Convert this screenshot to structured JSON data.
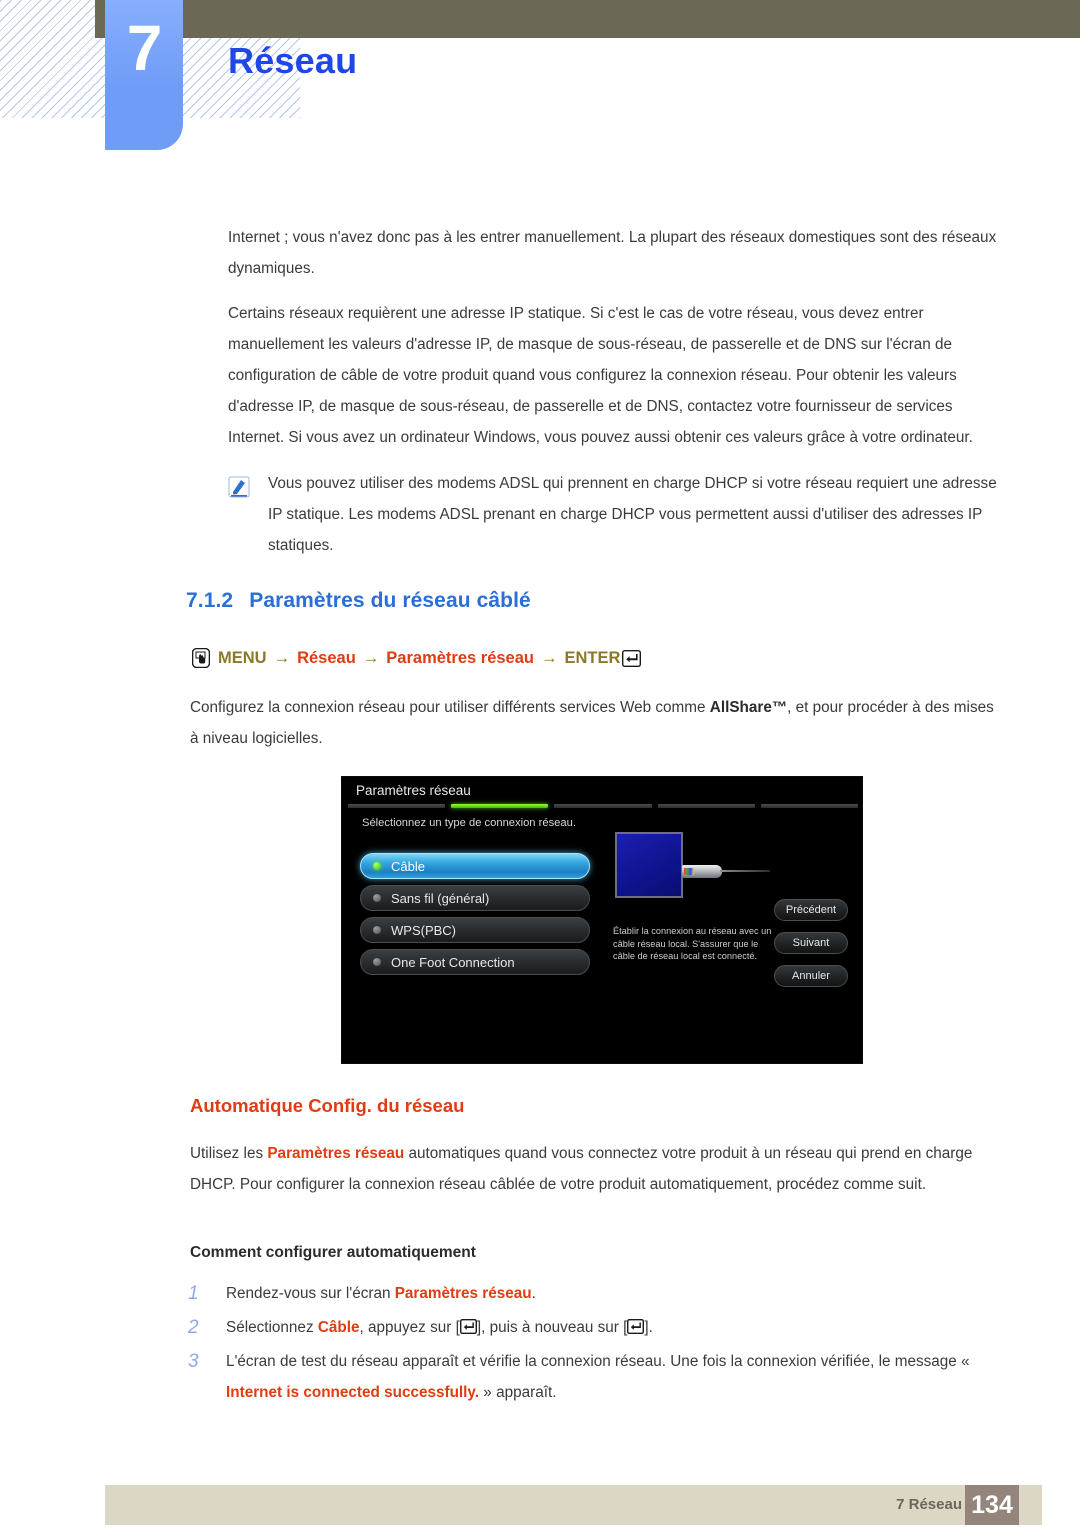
{
  "header": {
    "chapter_number": "7",
    "chapter_title": "Réseau"
  },
  "body": {
    "paragraph_1": "Internet ; vous n'avez donc pas à les entrer manuellement. La plupart des réseaux domestiques sont des réseaux dynamiques.",
    "paragraph_2": "Certains réseaux requièrent une adresse IP statique. Si c'est le cas de votre réseau, vous devez entrer manuellement les valeurs d'adresse IP, de masque de sous-réseau, de passerelle et de DNS sur l'écran de configuration de câble de votre produit quand vous configurez la connexion réseau. Pour obtenir les valeurs d'adresse IP, de masque de sous-réseau, de passerelle et de DNS, contactez votre fournisseur de services Internet. Si vous avez un ordinateur Windows, vous pouvez aussi obtenir ces valeurs grâce à votre ordinateur.",
    "note_text": "Vous pouvez utiliser des modems ADSL qui prennent en charge DHCP si votre réseau requiert une adresse IP statique. Les modems ADSL prenant en charge DHCP vous permettent aussi d'utiliser des adresses IP statiques."
  },
  "section": {
    "number": "7.1.2",
    "title": "Paramètres du réseau câblé"
  },
  "menu_path": {
    "item_1": "MENU",
    "arrow_1": "→",
    "item_2": "Réseau",
    "arrow_2": "→",
    "item_3": "Paramètres réseau",
    "arrow_3": "→",
    "item_4": "ENTER"
  },
  "intro": {
    "text_part_1": "Configurez la connexion réseau pour utiliser différents services Web comme ",
    "allshare": "AllShare™",
    "text_part_2": ", et pour procéder à des mises à niveau logicielles."
  },
  "tv_screen": {
    "title": "Paramètres réseau",
    "progress_steps": 5,
    "active_step": 2,
    "instruction": "Sélectionnez un type de connexion réseau.",
    "options": [
      {
        "label": "Câble",
        "selected": true
      },
      {
        "label": "Sans fil (général)",
        "selected": false
      },
      {
        "label": "WPS(PBC)",
        "selected": false
      },
      {
        "label": "One Foot Connection",
        "selected": false
      }
    ],
    "description": "Établir la connexion au réseau avec un câble réseau local. S'assurer que le câble de réseau local est connecté.",
    "buttons": [
      "Précédent",
      "Suivant",
      "Annuler"
    ]
  },
  "auto_section": {
    "heading": "Automatique Config. du réseau",
    "paragraph_part_1": "Utilisez les ",
    "paragraph_highlight": "Paramètres réseau",
    "paragraph_part_2": " automatiques quand vous connectez votre produit à un réseau qui prend en charge DHCP. Pour configurer la connexion réseau câblée de votre produit automatiquement, procédez comme suit.",
    "subheading": "Comment configurer automatiquement"
  },
  "steps": [
    {
      "number": "1",
      "text_part_1": "Rendez-vous sur l'écran ",
      "highlight_1": "Paramètres réseau",
      "text_part_2": "."
    },
    {
      "number": "2",
      "text_part_1": "Sélectionnez ",
      "highlight_1": "Câble",
      "text_part_2": ", appuyez sur [",
      "text_part_3": "], puis à nouveau sur [",
      "text_part_4": "]."
    },
    {
      "number": "3",
      "text_part_1": "L'écran de test du réseau apparaît et vérifie la connexion réseau. Une fois la connexion vérifiée, le message « ",
      "highlight_1": "Internet is connected successfully.",
      "text_part_2": " » apparaît."
    }
  ],
  "footer": {
    "label": "7 Réseau",
    "page_number": "134"
  },
  "colors": {
    "chapter_blue": "#1f47e8",
    "section_blue": "#2b6fd6",
    "accent_orange": "#e03c12",
    "menu_olive": "#8a7a28",
    "olive_bar": "#6b6855",
    "footer_band": "#dcd7c5",
    "page_box": "#93857c",
    "step_number": "#8fa8e8"
  }
}
